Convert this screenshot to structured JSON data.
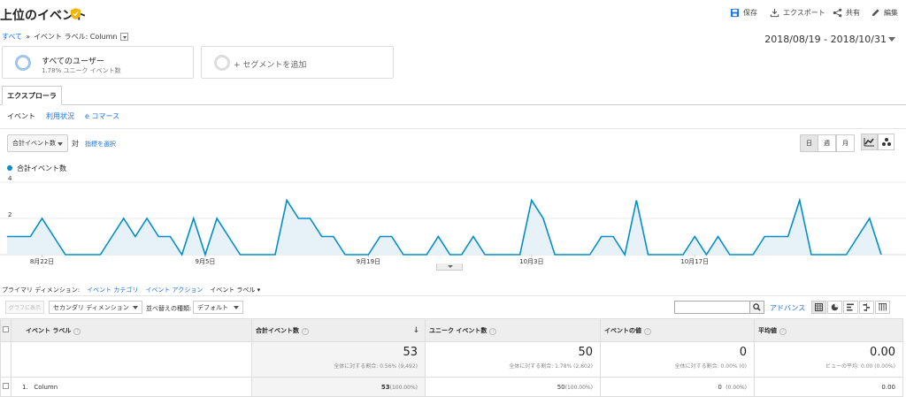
{
  "header": {
    "title": "上位のイベント",
    "actions": {
      "save": "保存",
      "export": "エクスポート",
      "share": "共有",
      "edit": "編集"
    }
  },
  "breadcrumb": {
    "all": "すべて",
    "separator": "»",
    "current": "イベント ラベル: Column"
  },
  "date_range": "2018/08/19 - 2018/10/31",
  "segments": {
    "seg1_name": "すべてのユーザー",
    "seg1_sub": "1.78% ユニーク イベント数",
    "seg2_label": "+ セグメントを追加"
  },
  "tabs": {
    "explorer": "エクスプローラ",
    "sub": [
      "イベント",
      "利用状況",
      "e コマース"
    ]
  },
  "chart_controls": {
    "metric": "合計イベント数",
    "vs": "対",
    "choose_metric": "指標を選択",
    "periods": [
      "日",
      "週",
      "月"
    ]
  },
  "chart_data": {
    "type": "area",
    "series": [
      {
        "name": "合計イベント数",
        "color": "#058dc7"
      }
    ],
    "ylim": [
      0,
      4
    ],
    "yticks": [
      "4",
      "2"
    ],
    "xticks": [
      {
        "label": "8月22日",
        "index": 3
      },
      {
        "label": "9月5日",
        "index": 17
      },
      {
        "label": "9月19日",
        "index": 31
      },
      {
        "label": "10月3日",
        "index": 45
      },
      {
        "label": "10月17日",
        "index": 59
      }
    ],
    "x": [
      "2018-08-19",
      "2018-08-20",
      "2018-08-21",
      "2018-08-22",
      "2018-08-23",
      "2018-08-24",
      "2018-08-25",
      "2018-08-26",
      "2018-08-27",
      "2018-08-28",
      "2018-08-29",
      "2018-08-30",
      "2018-08-31",
      "2018-09-01",
      "2018-09-02",
      "2018-09-03",
      "2018-09-04",
      "2018-09-05",
      "2018-09-06",
      "2018-09-07",
      "2018-09-08",
      "2018-09-09",
      "2018-09-10",
      "2018-09-11",
      "2018-09-12",
      "2018-09-13",
      "2018-09-14",
      "2018-09-15",
      "2018-09-16",
      "2018-09-17",
      "2018-09-18",
      "2018-09-19",
      "2018-09-20",
      "2018-09-21",
      "2018-09-22",
      "2018-09-23",
      "2018-09-24",
      "2018-09-25",
      "2018-09-26",
      "2018-09-27",
      "2018-09-28",
      "2018-09-29",
      "2018-09-30",
      "2018-10-01",
      "2018-10-02",
      "2018-10-03",
      "2018-10-04",
      "2018-10-05",
      "2018-10-06",
      "2018-10-07",
      "2018-10-08",
      "2018-10-09",
      "2018-10-10",
      "2018-10-11",
      "2018-10-12",
      "2018-10-13",
      "2018-10-14",
      "2018-10-15",
      "2018-10-16",
      "2018-10-17",
      "2018-10-18",
      "2018-10-19",
      "2018-10-20",
      "2018-10-21",
      "2018-10-22",
      "2018-10-23",
      "2018-10-24",
      "2018-10-25",
      "2018-10-26",
      "2018-10-27",
      "2018-10-28",
      "2018-10-29",
      "2018-10-30",
      "2018-10-31"
    ],
    "values": [
      1,
      1,
      1,
      2,
      1,
      0,
      0,
      0,
      0,
      1,
      2,
      1,
      2,
      1,
      1,
      0,
      2,
      0,
      2,
      1,
      0,
      0,
      0,
      0,
      3,
      2,
      2,
      1,
      1,
      0,
      0,
      0,
      1,
      1,
      0,
      0,
      0,
      1,
      0,
      0,
      1,
      0,
      0,
      0,
      0,
      3,
      2,
      0,
      0,
      0,
      0,
      1,
      1,
      0,
      3,
      0,
      0,
      0,
      0,
      1,
      0,
      1,
      0,
      0,
      0,
      1,
      1,
      1,
      3,
      0,
      0,
      0,
      0,
      1,
      2,
      0
    ]
  },
  "dimensions": {
    "label": "プライマリ ディメンション:",
    "items": [
      "イベント カテゴリ",
      "イベント アクション",
      "イベント ラベル"
    ]
  },
  "table_controls": {
    "plot_rows": "グラフに表示",
    "secondary_dimension": "セカンダリ ディメンション",
    "sort_type_label": "並べ替えの種類:",
    "sort_type": "デフォルト",
    "advanced": "アドバンス"
  },
  "table": {
    "headers": [
      "イベント ラベル",
      "合計イベント数",
      "ユニーク イベント数",
      "イベントの値",
      "平均値"
    ],
    "totals": [
      {
        "value": "53",
        "sub": "全体に対する割合: 0.56% (9,492)"
      },
      {
        "value": "50",
        "sub": "全体に対する割合: 1.78% (2,802)"
      },
      {
        "value": "0",
        "sub": "全体に対する割合: 0.00% (0)"
      },
      {
        "value": "0.00",
        "sub": "ビューの平均: 0.00 (0.00%)"
      }
    ],
    "rows": [
      {
        "index": "1.",
        "label": "Column",
        "total": "53",
        "total_pct": "(100.00%)",
        "unique": "50",
        "unique_pct": "(100.00%)",
        "value": "0",
        "value_pct": "(0.00%)",
        "avg": "0.00"
      }
    ]
  }
}
